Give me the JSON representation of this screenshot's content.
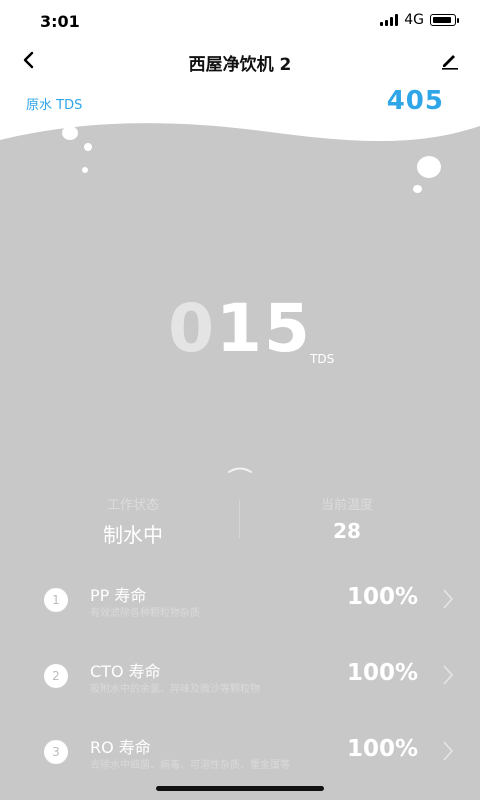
{
  "status": {
    "time": "3:01",
    "network": "4G"
  },
  "header": {
    "title": "西屋净饮机 2"
  },
  "raw_tds": {
    "label": "原水 TDS",
    "value": "405"
  },
  "purified": {
    "dim_digit": "0",
    "digits": "15",
    "unit": "TDS"
  },
  "stats": [
    {
      "label": "工作状态",
      "value": "制水中"
    },
    {
      "label": "当前温度",
      "value": "28"
    }
  ],
  "filters": [
    {
      "index": "1",
      "name": "PP 寿命",
      "desc": "有效滤除各种颗粒物杂质",
      "percent": "100%"
    },
    {
      "index": "2",
      "name": "CTO 寿命",
      "desc": "吸附水中的余氯、异味及微沙等颗粒物",
      "percent": "100%"
    },
    {
      "index": "3",
      "name": "RO 寿命",
      "desc": "去除水中细菌、病毒、可溶性杂质、重金属等",
      "percent": "100%"
    }
  ],
  "colors": {
    "accent": "#2ea6e8",
    "background": "#c8c8c8"
  },
  "icons": {
    "back": "chevron-left-icon",
    "edit": "pencil-icon",
    "expand": "chevron-up-icon",
    "row": "chevron-right-icon"
  }
}
